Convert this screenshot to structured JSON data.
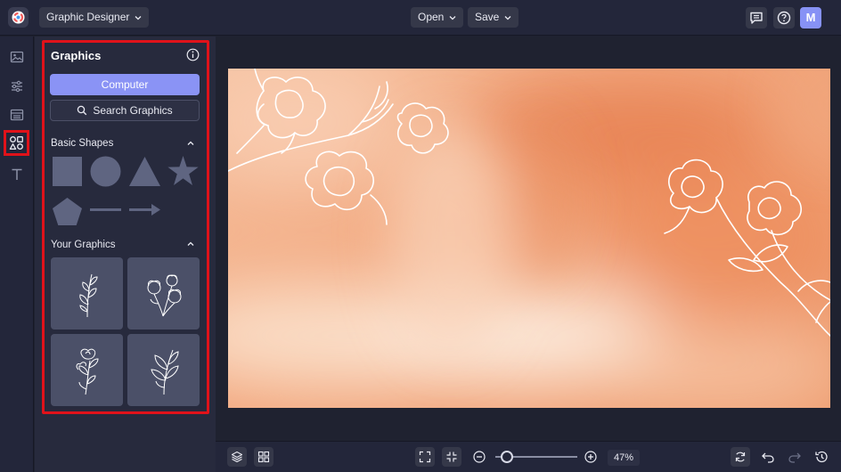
{
  "header": {
    "app_name": "Graphic Designer",
    "open_label": "Open",
    "save_label": "Save",
    "avatar_initial": "M"
  },
  "rail": {
    "items": [
      {
        "name": "image-icon"
      },
      {
        "name": "sliders-icon"
      },
      {
        "name": "layout-icon"
      },
      {
        "name": "shapes-icon",
        "active": true
      },
      {
        "name": "text-icon"
      }
    ]
  },
  "panel": {
    "title": "Graphics",
    "computer_label": "Computer",
    "search_label": "Search Graphics",
    "basic_shapes_title": "Basic Shapes",
    "basic_shapes": [
      "square",
      "circle",
      "triangle",
      "star",
      "pentagon",
      "line",
      "arrow"
    ],
    "your_graphics_title": "Your Graphics",
    "your_graphics": [
      "leaf-sprig",
      "cotton-flowers",
      "rose-stem",
      "leafy-branch"
    ]
  },
  "zoom": {
    "percent_label": "47%",
    "level": 0.14
  },
  "colors": {
    "accent": "#8a93f5",
    "highlight": "#e0121a",
    "shape_fill": "#5f6581",
    "canvas_base": "#f0a77c"
  }
}
